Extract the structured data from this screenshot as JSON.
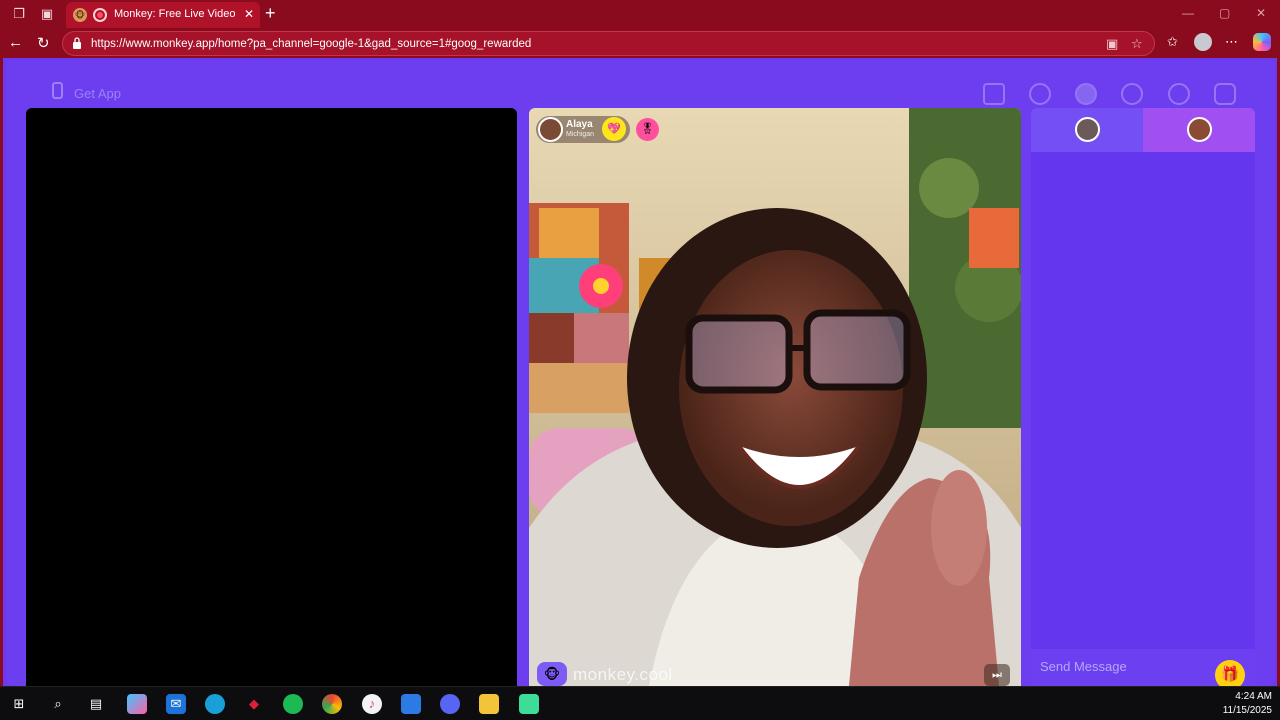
{
  "browser": {
    "tab_title": "Monkey: Free Live Video Chat",
    "tab_close": "✕",
    "new_tab": "+",
    "url": "https://www.monkey.app/home?pa_channel=google-1&gad_source=1#goog_rewarded",
    "window_controls": [
      "—",
      "▢",
      "✕"
    ]
  },
  "page": {
    "get_app_label": "Get App",
    "top_icons": [
      "shop-icon",
      "search-icon",
      "profile-icon",
      "history-icon",
      "chat-icon",
      "settings-icon"
    ],
    "peer": {
      "name": "Alaya",
      "location": "Michigan",
      "badge_icon": "heart-badge-icon",
      "badge2_icon": "gift-badge-icon"
    },
    "watermark": "monkey.cool",
    "skip_icon": "skip-icon",
    "chat": {
      "input_placeholder": "Send Message",
      "gift_icon": "gift-icon"
    }
  },
  "taskbar": {
    "time": "4:24 AM",
    "date": "11/15/2025",
    "apps": [
      "start",
      "search",
      "task-view",
      "copilot",
      "mail",
      "edge",
      "app-red",
      "spotify",
      "chrome",
      "itunes",
      "store",
      "discord",
      "file-explorer",
      "active-app"
    ]
  },
  "colors": {
    "browser_chrome": "#8a0b1d",
    "page_bg": "#6c39f1",
    "chat_panel": "#6436ee",
    "accent_pink": "#a050f0",
    "gift_yellow": "#ffd10f"
  }
}
